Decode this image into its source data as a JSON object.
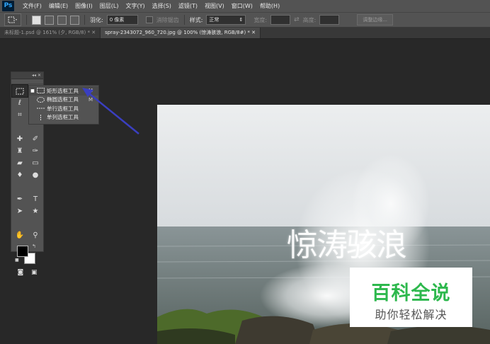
{
  "app": {
    "logo": "Ps"
  },
  "menu": [
    "文件(F)",
    "编辑(E)",
    "图像(I)",
    "图层(L)",
    "文字(Y)",
    "选择(S)",
    "滤镜(T)",
    "视图(V)",
    "窗口(W)",
    "帮助(H)"
  ],
  "options": {
    "feather_label": "羽化:",
    "feather_value": "0 像素",
    "antialias_label": "消除锯齿",
    "style_label": "样式:",
    "style_value": "正常",
    "width_label": "宽度:",
    "height_label": "高度:",
    "refine_edge": "调整边缘..."
  },
  "tabs": [
    {
      "label": "未标题-1.psd @ 161% (夕, RGB/8) *",
      "active": false
    },
    {
      "label": "spray-2343072_960_720.jpg @ 100% (惊涛骇浪, RGB/8#) *",
      "active": true
    }
  ],
  "toolbox": {
    "collapse": "◂◂",
    "close": "✕"
  },
  "flyout": [
    {
      "label": "矩形选框工具",
      "key": "M",
      "active": true,
      "icon": "rect-marquee-icon"
    },
    {
      "label": "椭圆选框工具",
      "key": "M",
      "active": false,
      "icon": "ellipse-marquee-icon"
    },
    {
      "label": "单行选框工具",
      "key": "",
      "active": false,
      "icon": "single-row-marquee-icon"
    },
    {
      "label": "单列选框工具",
      "key": "",
      "active": false,
      "icon": "single-column-marquee-icon"
    }
  ],
  "canvas": {
    "text_layer": "惊涛骇浪"
  },
  "watermark": {
    "name": "百科全说",
    "slogan": "助你轻松解决"
  },
  "colors": {
    "foreground": "#000000",
    "background": "#ffffff",
    "arrow": "#3a3fc0",
    "brand": "#2db84d"
  }
}
